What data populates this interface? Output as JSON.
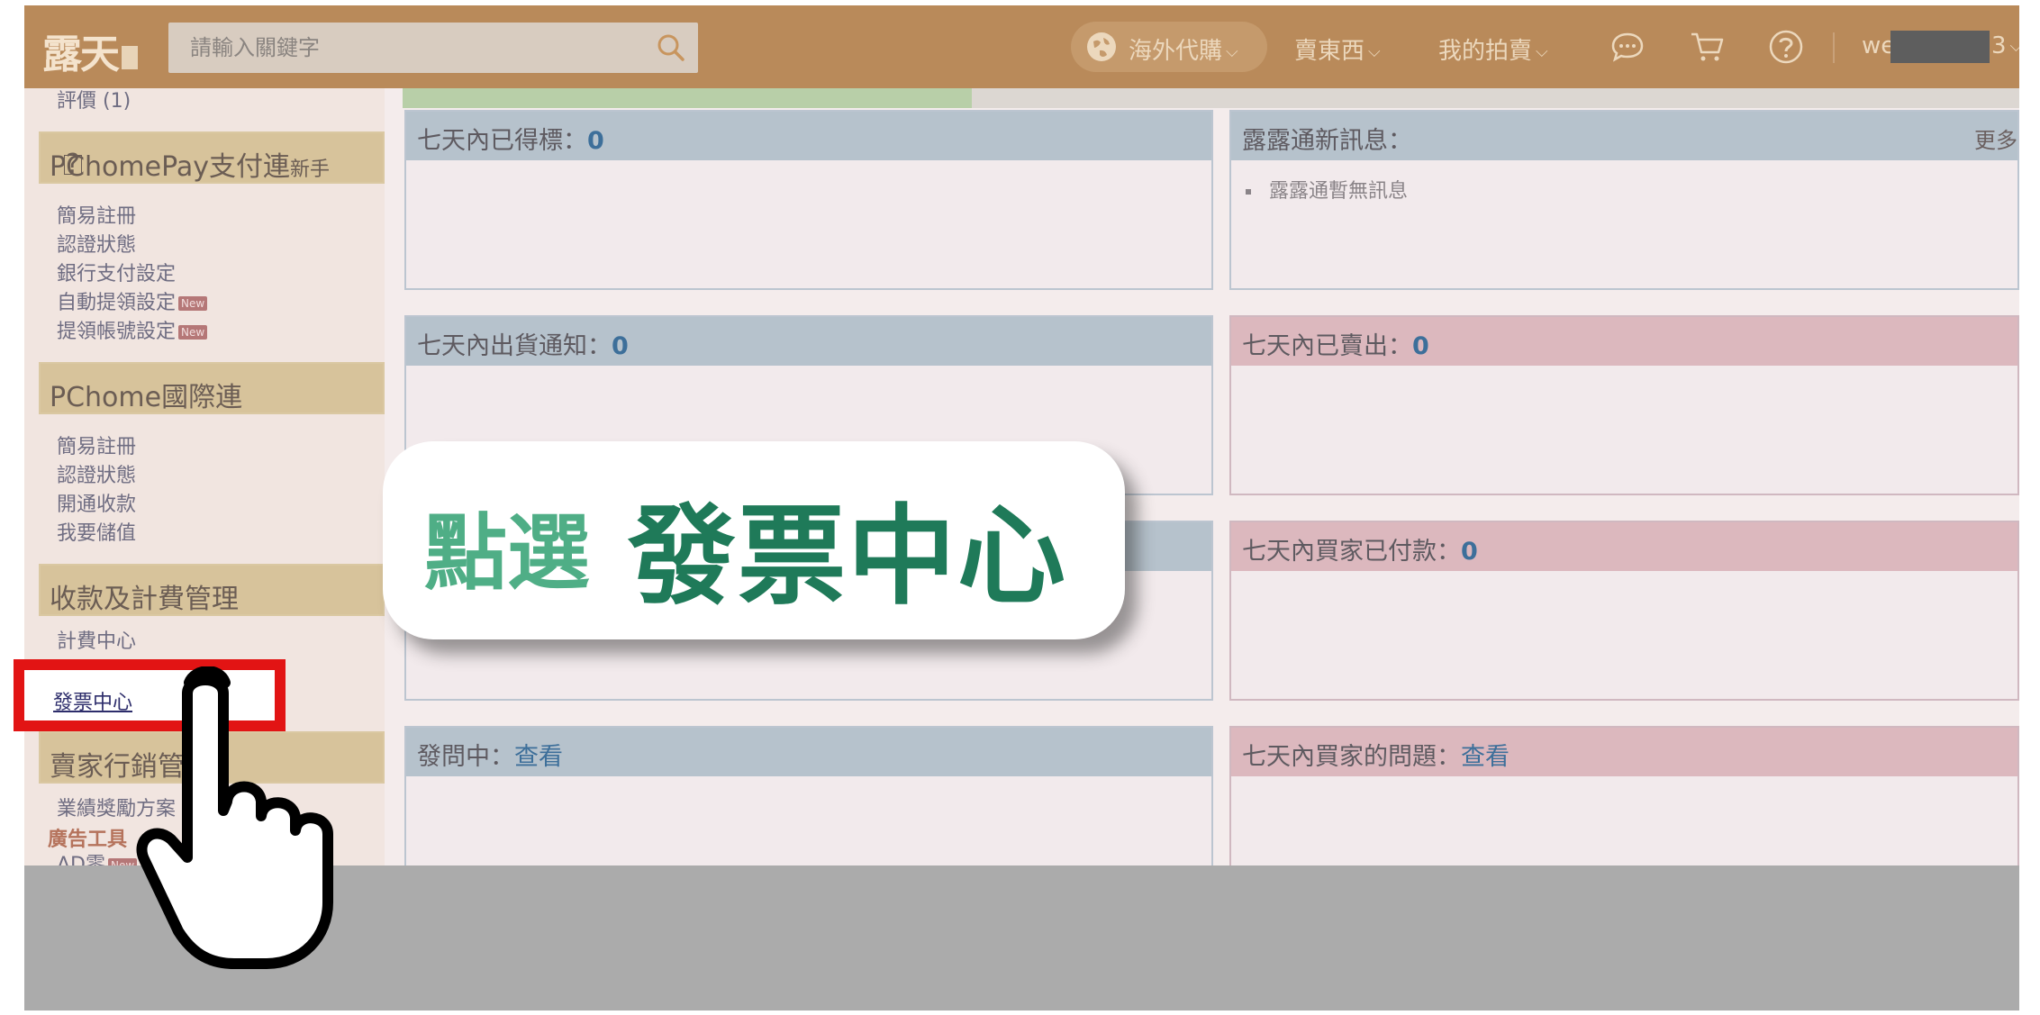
{
  "topbar": {
    "logo": "露天",
    "search_placeholder": "請輸入關鍵字",
    "nav": {
      "overseas": "海外代購",
      "sell": "賣東西",
      "my_auction": "我的拍賣"
    },
    "user_prefix": "we",
    "user_suffix": "3"
  },
  "sidebar": {
    "top_partial": "評價 (1)",
    "pchomepay": {
      "title": "PChomePay支付連",
      "help": "?",
      "newbie": "新手",
      "items": [
        "簡易註冊",
        "認證狀態",
        "銀行支付設定",
        "自動提領設定",
        "提領帳號設定"
      ],
      "new_badge": "New"
    },
    "pchome_intl": {
      "title": "PChome國際連",
      "items": [
        "簡易註冊",
        "認證狀態",
        "開通收款",
        "我要儲值"
      ]
    },
    "billing": {
      "title": "收款及計費管理",
      "items": [
        "計費中心",
        "發票中心"
      ]
    },
    "marketing": {
      "title": "賣家行銷管理",
      "items": [
        "業績獎勵方案"
      ],
      "ad_tools": "廣告工具",
      "ad_item": "AD零"
    }
  },
  "panels": {
    "won": {
      "label": "七天內已得標：",
      "count": "0"
    },
    "news": {
      "label": "露露通新訊息：",
      "more": "更多",
      "message": "露露通暫無訊息"
    },
    "ship": {
      "label": "七天內出貨通知：",
      "count": "0"
    },
    "sold": {
      "label": "七天內已賣出：",
      "count": "0"
    },
    "paid": {
      "label": "七天內買家已付款：",
      "count": "0"
    },
    "ask": {
      "label": "發問中：",
      "link": "查看"
    },
    "questions": {
      "label": "七天內買家的問題：",
      "link": "查看"
    }
  },
  "overlay": {
    "callout_prefix": "點選",
    "callout_target": "發票中心",
    "highlight_label": "發票中心"
  },
  "colors": {
    "topbar": "#b98a5a",
    "callout_light": "#4fae86",
    "callout_dark": "#1f7a59",
    "highlight": "#e21414"
  }
}
